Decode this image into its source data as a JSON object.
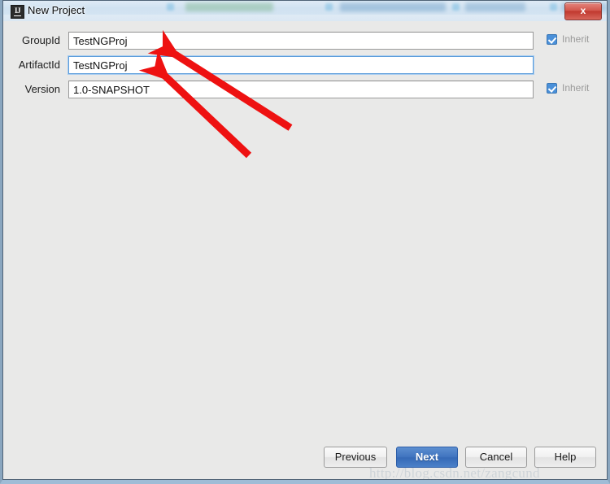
{
  "window": {
    "title": "New Project",
    "app_icon": "intellij-idea-icon",
    "close_label": "x"
  },
  "form": {
    "rows": [
      {
        "label": "GroupId",
        "value": "TestNGProj",
        "focused": false,
        "inherit_label": "Inherit",
        "inherit_checked": true
      },
      {
        "label": "ArtifactId",
        "value": "TestNGProj",
        "focused": true,
        "inherit_label": "",
        "inherit_checked": false
      },
      {
        "label": "Version",
        "value": "1.0-SNAPSHOT",
        "focused": false,
        "inherit_label": "Inherit",
        "inherit_checked": true
      }
    ]
  },
  "buttons": {
    "previous": "Previous",
    "next": "Next",
    "cancel": "Cancel",
    "help": "Help"
  },
  "watermark": {
    "text": "http://blog.csdn.net/zangcund"
  },
  "colors": {
    "accent_blue": "#3f73bf",
    "focus_border": "#5d9ddb",
    "checkbox_blue": "#4a90d9",
    "close_red": "#c0392f",
    "annotation_red": "#ee1111",
    "dialog_bg": "#e9e9e8"
  },
  "annotations": {
    "arrow_1": "points at GroupId field",
    "arrow_2": "points at ArtifactId field"
  }
}
